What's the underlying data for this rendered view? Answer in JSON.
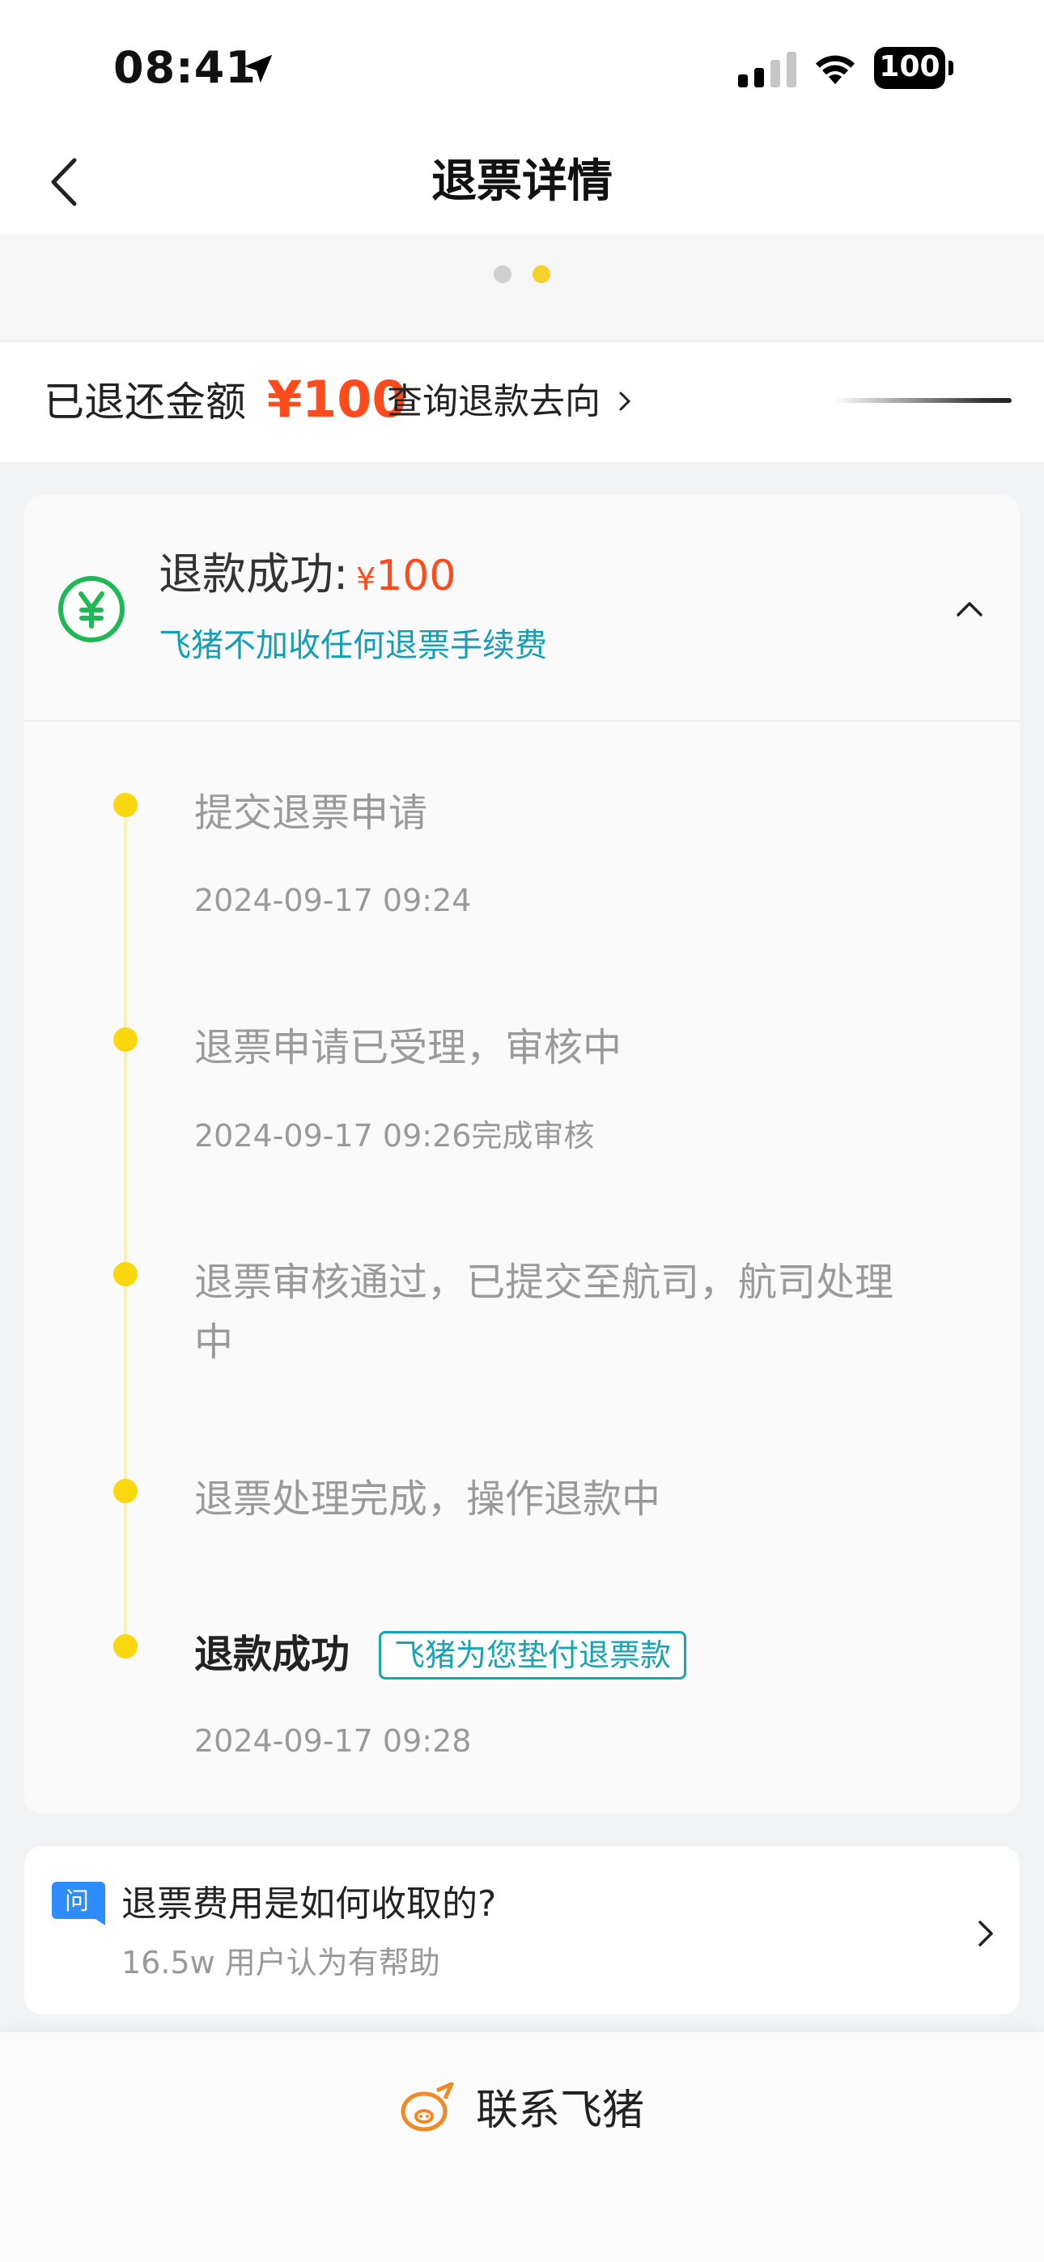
{
  "status_bar": {
    "time": "08:41",
    "battery": "100"
  },
  "nav": {
    "title": "退票详情"
  },
  "refund_bar": {
    "label": "已退还金额",
    "amount": "¥100",
    "query_link": "查询退款去向"
  },
  "card": {
    "status_label": "退款成功:",
    "currency": "¥",
    "amount": "100",
    "note": "飞猪不加收任何退票手续费",
    "timeline": [
      {
        "title": "提交退票申请",
        "time": "2024-09-17 09:24"
      },
      {
        "title": "退票申请已受理，审核中",
        "time": "2024-09-17 09:26完成审核"
      },
      {
        "title": "退票审核通过，已提交至航司，航司处理中"
      },
      {
        "title": "退票处理完成，操作退款中"
      },
      {
        "title": "退款成功",
        "badge": "飞猪为您垫付退票款",
        "time": "2024-09-17 09:28"
      }
    ]
  },
  "faq": {
    "title": "退票费用是如何收取的?",
    "subtitle": "16.5w 用户认为有帮助",
    "icon_text": "问"
  },
  "bottom": {
    "contact_label": "联系飞猪"
  },
  "colors": {
    "accent_orange": "#ff4a1c",
    "accent_teal": "#1aa3b4",
    "timeline_yellow": "#fad70f",
    "yen_green": "#1db954"
  }
}
